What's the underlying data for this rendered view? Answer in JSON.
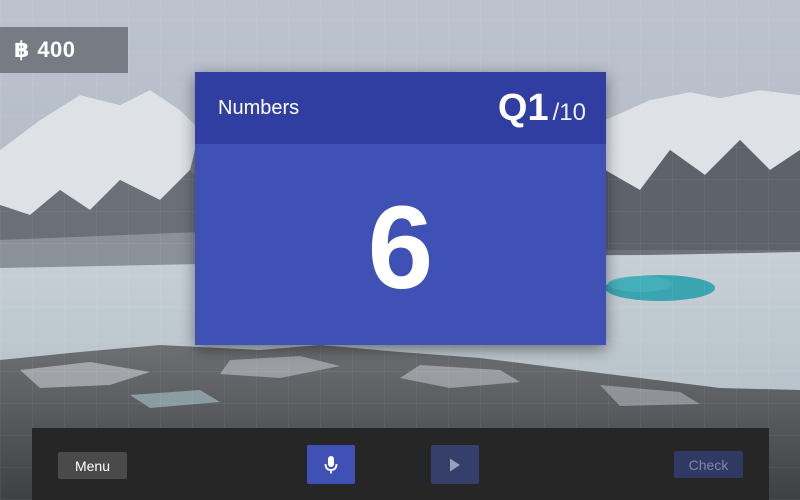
{
  "hud": {
    "coin_icon": "฿",
    "coin_icon_name": "baht-coin-icon",
    "coins": "400"
  },
  "card": {
    "category": "Numbers",
    "question_current": "Q1",
    "question_separator": "/",
    "question_total": "10",
    "prompt": "6",
    "header_color": "#2f3ea0",
    "body_color": "#3f51b5"
  },
  "controls": {
    "menu_label": "Menu",
    "mic_icon": "microphone-icon",
    "play_icon": "play-icon",
    "check_label": "Check",
    "accent_color": "#3f51b5",
    "disabled_color": "#303864"
  }
}
